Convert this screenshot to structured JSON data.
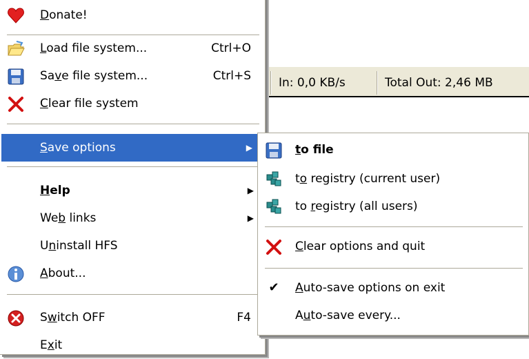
{
  "status": {
    "in": "In: 0,0 KB/s",
    "total_out": "Total Out: 2,46 MB"
  },
  "main_menu": {
    "donate": {
      "pre": "",
      "u": "D",
      "post": "onate!"
    },
    "load": {
      "pre": "",
      "u": "L",
      "post": "oad file system...",
      "shortcut": "Ctrl+O"
    },
    "save": {
      "pre": "Sa",
      "u": "v",
      "post": "e file system...",
      "shortcut": "Ctrl+S"
    },
    "clear": {
      "pre": "",
      "u": "C",
      "post": "lear file system"
    },
    "save_options": {
      "pre": "",
      "u": "S",
      "post": "ave options"
    },
    "help": {
      "pre": "",
      "u": "H",
      "post": "elp"
    },
    "web_links": {
      "pre": "We",
      "u": "b",
      "post": " links"
    },
    "uninstall": {
      "pre": "U",
      "u": "n",
      "post": "install HFS"
    },
    "about": {
      "pre": "",
      "u": "A",
      "post": "bout..."
    },
    "switch_off": {
      "pre": "S",
      "u": "w",
      "post": "itch OFF",
      "shortcut": "F4"
    },
    "exit": {
      "pre": "E",
      "u": "x",
      "post": "it"
    }
  },
  "sub_menu": {
    "to_file": {
      "pre": "",
      "u": "t",
      "post": "o file"
    },
    "to_registry_current": {
      "pre": "t",
      "u": "o",
      "post": " registry (current user)"
    },
    "to_registry_all": {
      "pre": "to ",
      "u": "r",
      "post": "egistry (all users)"
    },
    "clear_quit": {
      "pre": "",
      "u": "C",
      "post": "lear options and quit"
    },
    "auto_save_exit": {
      "pre": "",
      "u": "A",
      "post": "uto-save options on exit"
    },
    "auto_save_every": {
      "pre": "A",
      "u": "u",
      "post": "to-save every..."
    }
  },
  "colors": {
    "highlight": "#316ac5",
    "menu_border": "#aca899"
  }
}
